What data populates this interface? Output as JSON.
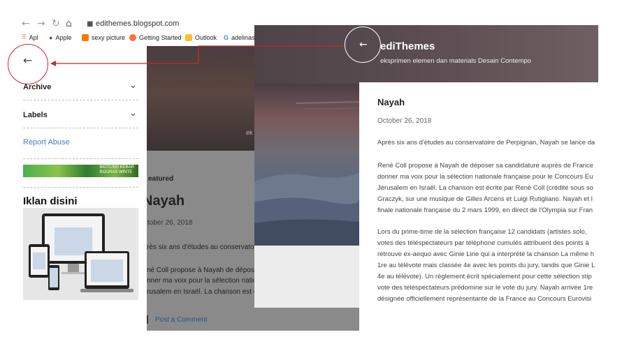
{
  "browser": {
    "url": "edithemes.blogspot.com",
    "nav_icons": [
      "back-icon",
      "forward-icon",
      "reload-icon",
      "home-icon"
    ],
    "bookmarks": [
      {
        "label": "Apl",
        "icon": "apps-grid-icon",
        "color": "#e53935"
      },
      {
        "label": "Apple",
        "icon": "apple-icon",
        "color": "#555555"
      },
      {
        "label": "sexy picture",
        "icon": "blogger-icon",
        "color": "#f57c00"
      },
      {
        "label": "Getting Started",
        "icon": "firefox-icon",
        "color": "#ff7043"
      },
      {
        "label": "Outlook",
        "icon": "folder-icon",
        "color": "#fbc02d"
      },
      {
        "label": "adelinas",
        "icon": "google-icon",
        "color": "#4285f4"
      }
    ]
  },
  "sidebar": {
    "back_icon": "arrow-left-icon",
    "items": [
      {
        "label": "Archive",
        "expandable": true
      },
      {
        "label": "Labels",
        "expandable": true
      }
    ],
    "report_abuse": "Report Abuse",
    "banner_text": "BIOTLINS KEBAR\nBOGRAS WINTE",
    "ad_title": "Iklan disini"
  },
  "background_page": {
    "hero_text": "ek",
    "featured_label": "eatured",
    "post_title": "Nayah",
    "post_date": "ctober 26, 2018",
    "text_lines": [
      "rès six ans d'études au conservatoi",
      "",
      "né Coll propose à Nayah de dépose",
      "nner ma voix pour la sélection natio",
      "rusalem en Israël. La chanson est é"
    ],
    "post_comment": "Post a Comment"
  },
  "foreground": {
    "site_title": "ediThemes",
    "site_description": "eksprimen elemen dan materials Desain Contempo",
    "post_title": "Nayah",
    "post_date": "October 26, 2018",
    "paragraphs": [
      [
        "Après six ans d'études au conservatoire de Perpignan, Nayah se lance da"
      ],
      [
        "René Coll propose à Nayah de déposer sa candidature auprès de France",
        "donner ma voix pour la sélection nationale française pour le Concours Eu",
        "Jérusalem en Israël. La chanson est écrite par René Coll (crédité sous so",
        "Graczyk, sur une musique de Gilles Arcens et Luigi Rutigliano. Nayah et l",
        "finale nationale française du 2 mars 1999, en direct de l'Olympia sur Fran"
      ],
      [
        "Lors du prime-time de la sélection française 12 candidats (artistes solo,",
        "votes des téléspectateurs par téléphone cumulés attribuent des points à",
        "retrouve ex-aequo avec Ginie Line qui a interprété la chanson La même h",
        "1re au télévote mais classée 4e avec les points du jury, tandis que Ginie L",
        "4e au télévote). Un règlement écrit spécialement pour cette sélection stip",
        "vote des téléspectateurs prédomine sur le vote du jury. Nayah arrivée 1re",
        "désignée officiellement représentante de la France au Concours Eurovisi"
      ]
    ]
  },
  "colors": {
    "annotation_red": "#c62828",
    "link_blue": "#3f7fc1"
  }
}
